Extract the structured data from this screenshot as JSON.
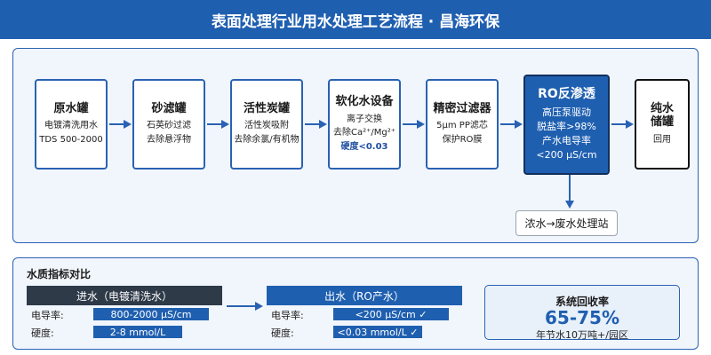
{
  "header": {
    "title": "表面处理行业用水处理工艺流程 · 昌海环保"
  },
  "flow": {
    "steps": [
      {
        "title": "原水罐",
        "lines": [
          "电镀清洗用水",
          "TDS 500-2000"
        ]
      },
      {
        "title": "砂滤罐",
        "lines": [
          "石英砂过滤",
          "去除悬浮物"
        ]
      },
      {
        "title": "活性炭罐",
        "lines": [
          "活性炭吸附",
          "去除余氯/有机物"
        ]
      },
      {
        "title": "软化水设备",
        "lines": [
          "离子交换",
          "去除Ca²⁺/Mg²⁺"
        ],
        "emphasis": "硬度<0.03"
      },
      {
        "title": "精密过滤器",
        "lines": [
          "5μm PP滤芯",
          "保护RO膜"
        ]
      },
      {
        "title": "RO反渗透",
        "lines": [
          "高压泵驱动",
          "脱盐率>98%",
          "产水电导率",
          "<200 μS/cm"
        ]
      },
      {
        "title": "纯水\n储罐",
        "lines": [
          "回用"
        ]
      }
    ],
    "brine_label": "浓水→废水处理站"
  },
  "water_quality": {
    "title": "水质指标对比",
    "inlet": {
      "header": "进水（电镀清洗水）",
      "conductivity_label": "电导率:",
      "conductivity_value": "800-2000 μS/cm",
      "hardness_label": "硬度:",
      "hardness_value": "2-8 mmol/L"
    },
    "outlet": {
      "header": "出水（RO产水）",
      "conductivity_label": "电导率:",
      "conductivity_value": "<200 μS/cm ✓",
      "hardness_label": "硬度:",
      "hardness_value": "<0.03 mmol/L ✓"
    },
    "recovery": {
      "label": "系统回收率",
      "value": "65-75%",
      "note": "年节水10万吨+/园区"
    }
  },
  "colors": {
    "primary": "#1f5fb0",
    "dark": "#2e3a48",
    "panel": "#f1f6fc"
  }
}
